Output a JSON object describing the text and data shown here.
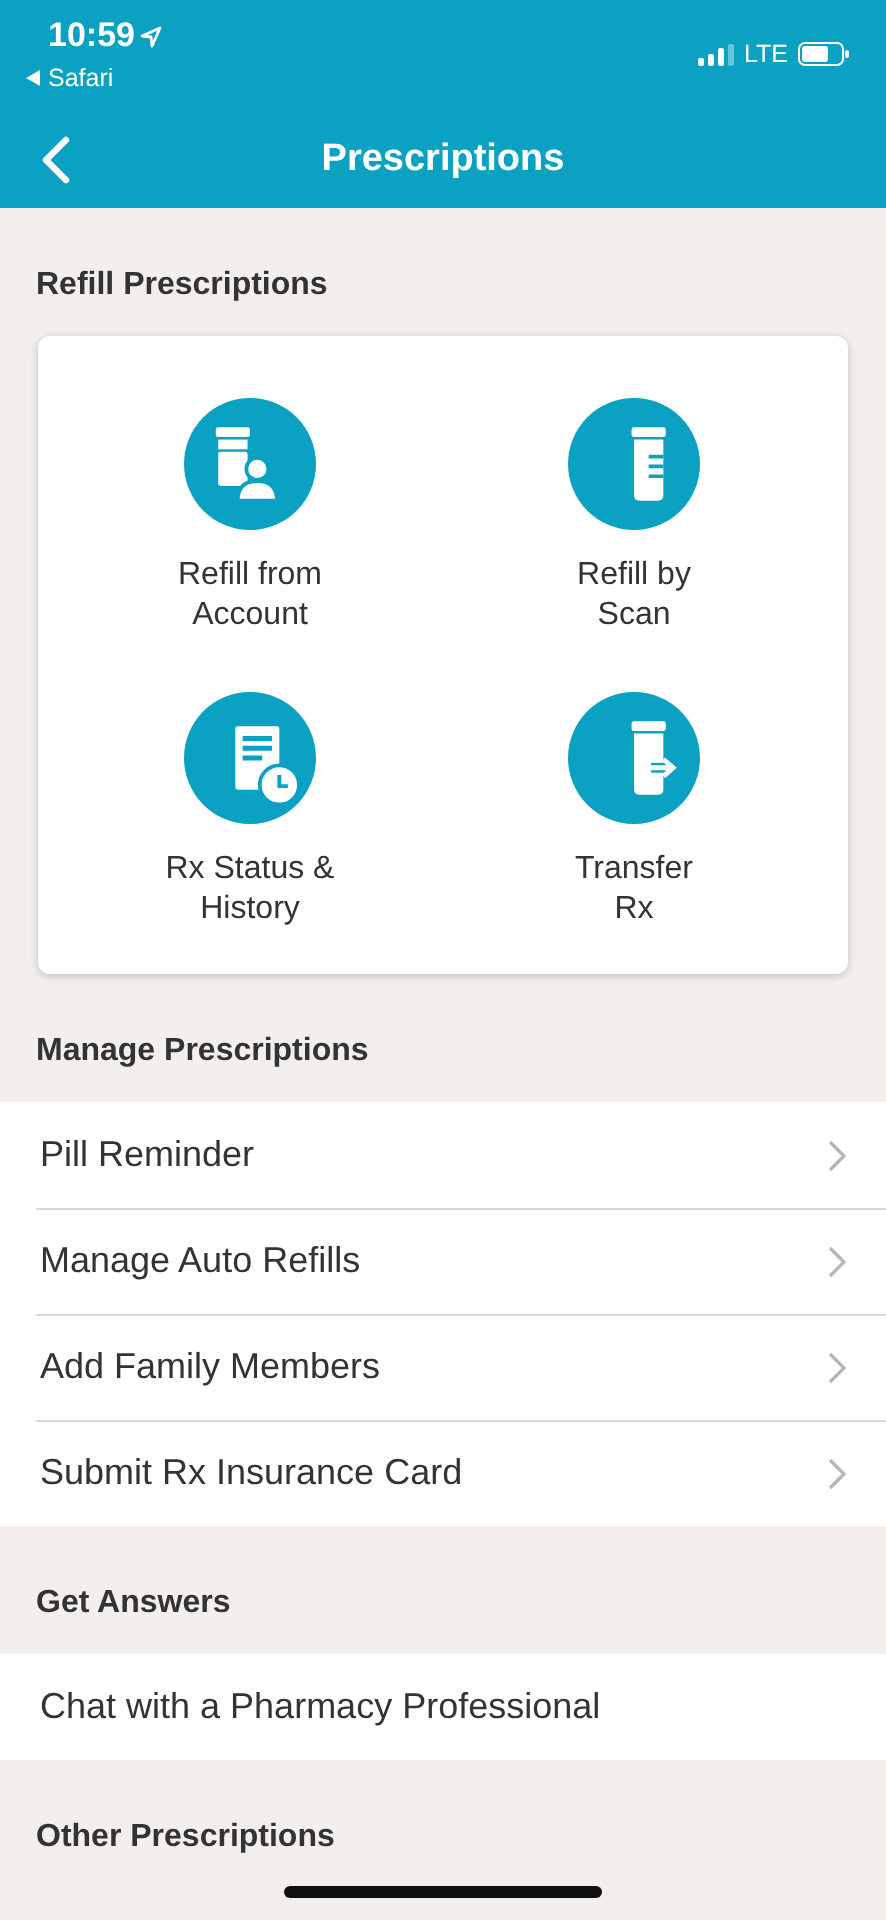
{
  "status_bar": {
    "time": "10:59",
    "back_app": "Safari",
    "network": "LTE"
  },
  "nav": {
    "title": "Prescriptions"
  },
  "sections": [
    {
      "title": "Refill Prescriptions",
      "kind": "grid",
      "actions": [
        {
          "label": "Refill from Account"
        },
        {
          "label": "Refill by\nScan"
        },
        {
          "label": "Rx Status & History"
        },
        {
          "label": "Transfer\nRx"
        }
      ]
    },
    {
      "title": "Manage Prescriptions",
      "kind": "list",
      "items": [
        {
          "label": "Pill Reminder",
          "chevron": true
        },
        {
          "label": "Manage Auto Refills",
          "chevron": true
        },
        {
          "label": "Add Family Members",
          "chevron": true
        },
        {
          "label": "Submit Rx Insurance Card",
          "chevron": true
        }
      ]
    },
    {
      "title": "Get Answers",
      "kind": "list",
      "items": [
        {
          "label": "Chat with a Pharmacy Professional",
          "chevron": false
        }
      ]
    },
    {
      "title": "Other Prescriptions",
      "kind": "list"
    }
  ]
}
